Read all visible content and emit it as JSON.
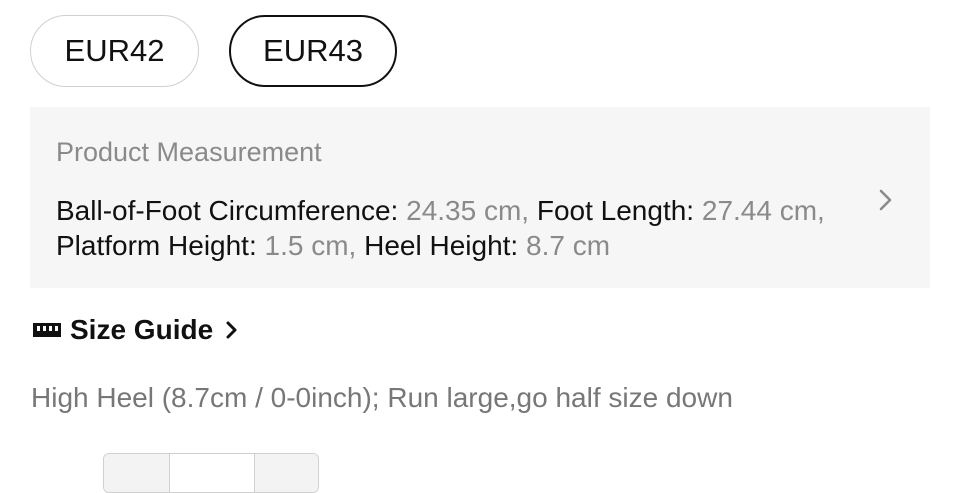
{
  "sizes": [
    {
      "label": "EUR42",
      "selected": false
    },
    {
      "label": "EUR43",
      "selected": true
    }
  ],
  "measurement": {
    "title": "Product Measurement",
    "items": [
      {
        "key": "Ball-of-Foot Circumference:",
        "value": "24.35 cm,"
      },
      {
        "key": "Foot Length:",
        "value": "27.44 cm,"
      },
      {
        "key": "Platform Height:",
        "value": "1.5 cm,"
      },
      {
        "key": "Heel Height:",
        "value": "8.7 cm"
      }
    ]
  },
  "size_guide": {
    "label": "Size Guide",
    "icon": "ruler-icon"
  },
  "note": "High Heel (8.7cm / 0-0inch); Run large,go half size down",
  "colors": {
    "accent_text": "#111111",
    "muted_text": "#8a8a8a",
    "panel_bg": "#f6f6f6"
  }
}
